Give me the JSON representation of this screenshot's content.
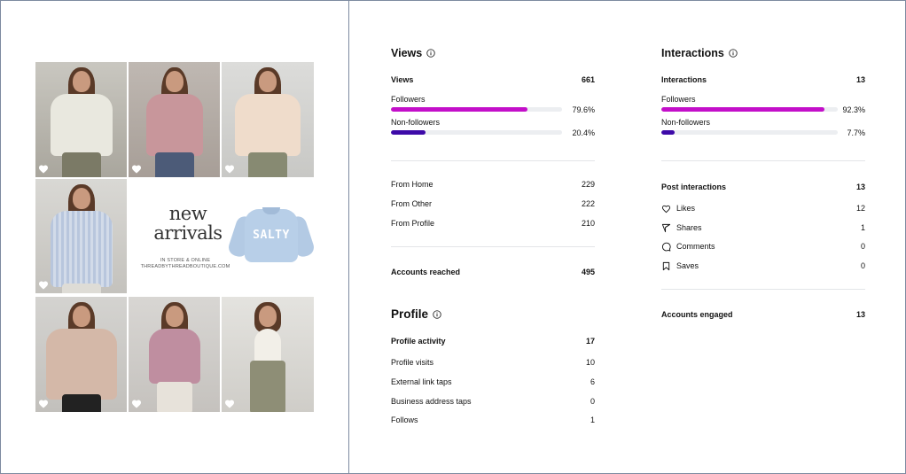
{
  "colors": {
    "followers_bar": "#c30fc9",
    "non_followers_bar": "#3d0aa8",
    "bar_track": "#eceef1"
  },
  "post": {
    "promo_title": "new arrivals",
    "promo_subtitle_line1": "IN STORE & ONLINE",
    "promo_subtitle_line2": "THREADBYTHREADBOUTIQUE.COM",
    "sweatshirt_text": "SALTY"
  },
  "views": {
    "section_title": "Views",
    "total_label": "Views",
    "total_value": "661",
    "followers_label": "Followers",
    "followers_pct": "79.6%",
    "followers_fraction": 0.796,
    "non_followers_label": "Non-followers",
    "non_followers_pct": "20.4%",
    "non_followers_fraction": 0.204,
    "sources": [
      {
        "label": "From Home",
        "value": "229"
      },
      {
        "label": "From Other",
        "value": "222"
      },
      {
        "label": "From Profile",
        "value": "210"
      }
    ],
    "reached_label": "Accounts reached",
    "reached_value": "495"
  },
  "profile": {
    "section_title": "Profile",
    "activity_label": "Profile activity",
    "activity_value": "17",
    "items": [
      {
        "label": "Profile visits",
        "value": "10"
      },
      {
        "label": "External link taps",
        "value": "6"
      },
      {
        "label": "Business address taps",
        "value": "0"
      },
      {
        "label": "Follows",
        "value": "1"
      }
    ]
  },
  "interactions": {
    "section_title": "Interactions",
    "total_label": "Interactions",
    "total_value": "13",
    "followers_label": "Followers",
    "followers_pct": "92.3%",
    "followers_fraction": 0.923,
    "non_followers_label": "Non-followers",
    "non_followers_pct": "7.7%",
    "non_followers_fraction": 0.077,
    "post_label": "Post interactions",
    "post_value": "13",
    "items": [
      {
        "label": "Likes",
        "value": "12",
        "icon": "heart-icon"
      },
      {
        "label": "Shares",
        "value": "1",
        "icon": "send-icon"
      },
      {
        "label": "Comments",
        "value": "0",
        "icon": "comment-icon"
      },
      {
        "label": "Saves",
        "value": "0",
        "icon": "bookmark-icon"
      }
    ],
    "engaged_label": "Accounts engaged",
    "engaged_value": "13"
  }
}
